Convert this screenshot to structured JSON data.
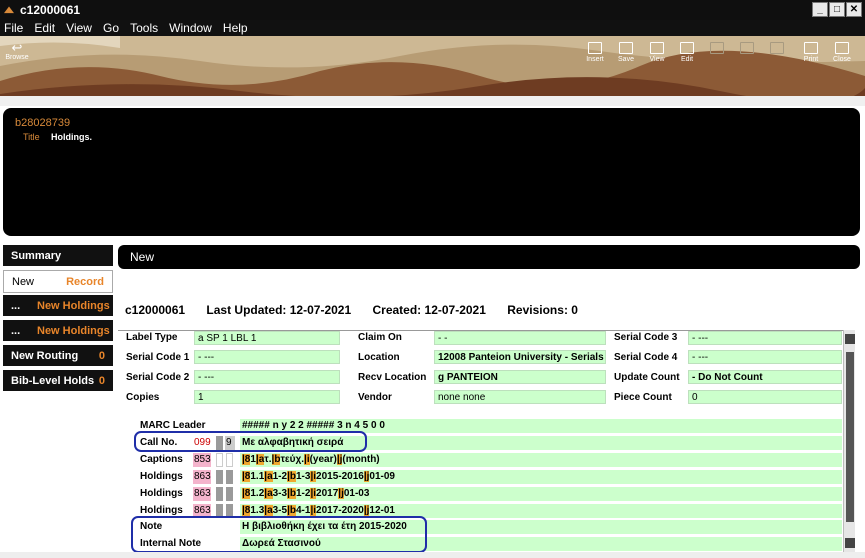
{
  "window": {
    "title": "c12000061"
  },
  "menu": [
    "File",
    "Edit",
    "View",
    "Go",
    "Tools",
    "Window",
    "Help"
  ],
  "toolbar": {
    "browse": "Browse",
    "items": [
      "Insert",
      "Save",
      "View",
      "Edit",
      "",
      "",
      "",
      "Print",
      "Close"
    ]
  },
  "bib": {
    "number": "b28028739",
    "title_label": "Title",
    "title": "Holdings."
  },
  "nav": {
    "summary": "Summary",
    "new": "New",
    "record": "Record",
    "nh1_prefix": "...",
    "nh1": "New Holdings",
    "nh2_prefix": "...",
    "nh2": "New Holdings",
    "routing": "New Routing",
    "routing_count": "0",
    "holds": "Bib-Level Holds",
    "holds_count": "0"
  },
  "main": {
    "header": "New",
    "record_id": "c12000061",
    "last_updated": "Last Updated: 12-07-2021",
    "created": "Created: 12-07-2021",
    "revisions": "Revisions: 0"
  },
  "fields": {
    "label_type_l": "Label Type",
    "label_type_v": "a  SP 1 LBL 1",
    "claim_on_l": "Claim On",
    "claim_on_v": "-  -",
    "serial_code3_l": "Serial Code 3",
    "serial_code3_v": "- ---",
    "serial_code1_l": "Serial Code 1",
    "serial_code1_v": "- ---",
    "location_l": "Location",
    "location_v": "12008 Panteion University - Serials",
    "serial_code4_l": "Serial Code 4",
    "serial_code4_v": "- ---",
    "serial_code2_l": "Serial Code 2",
    "serial_code2_v": "- ---",
    "recv_location_l": "Recv Location",
    "recv_location_v": "g   PANTEION",
    "update_count_l": "Update Count",
    "update_count_v": "- Do Not Count",
    "copies_l": "Copies",
    "copies_v": "1",
    "vendor_l": "Vendor",
    "vendor_v": "none  none",
    "piece_count_l": "Piece Count",
    "piece_count_v": "0"
  },
  "marc": {
    "leader_label": "MARC Leader",
    "leader_value": "#####  n  y       2  2  #####  3  n     4  5  0  0",
    "call_label": "Call No.",
    "call_tag": "099",
    "call_ind2": "9",
    "call_value": "Με αλφαβητική σειρά",
    "captions_label": "Captions",
    "captions_tag": "853",
    "captions_value": [
      "|8",
      "1",
      "|a",
      "τ.",
      "|b",
      "τεύχ.",
      "|i",
      "(year)",
      "|j",
      "(month)"
    ],
    "holdings": [
      {
        "label": "Holdings",
        "tag": "863",
        "value": [
          "|8",
          "1.1",
          "|a",
          "1-2",
          "|b",
          "1-3",
          "|i",
          "2015-2016",
          "|j",
          "01-09"
        ]
      },
      {
        "label": "Holdings",
        "tag": "863",
        "value": [
          "|8",
          "1.2",
          "|a",
          "3-3",
          "|b",
          "1-2",
          "|i",
          "2017",
          "|j",
          "01-03"
        ]
      },
      {
        "label": "Holdings",
        "tag": "863",
        "value": [
          "|8",
          "1.3",
          "|a",
          "3-5",
          "|b",
          "4-1",
          "|i",
          "2017-2020",
          "|j",
          "12-01"
        ]
      }
    ],
    "note_label": "Note",
    "note_value": "Η βιβλιοθήκη έχει τα έτη 2015-2020",
    "internal_note_label": "Internal Note",
    "internal_note_value": "Δωρεά Στασινού"
  },
  "colors": {
    "accent": "#e8852a",
    "field_bg": "#ccffcc",
    "annotation": "#1f2ea8",
    "tag_bg": "#f4b4cc"
  }
}
